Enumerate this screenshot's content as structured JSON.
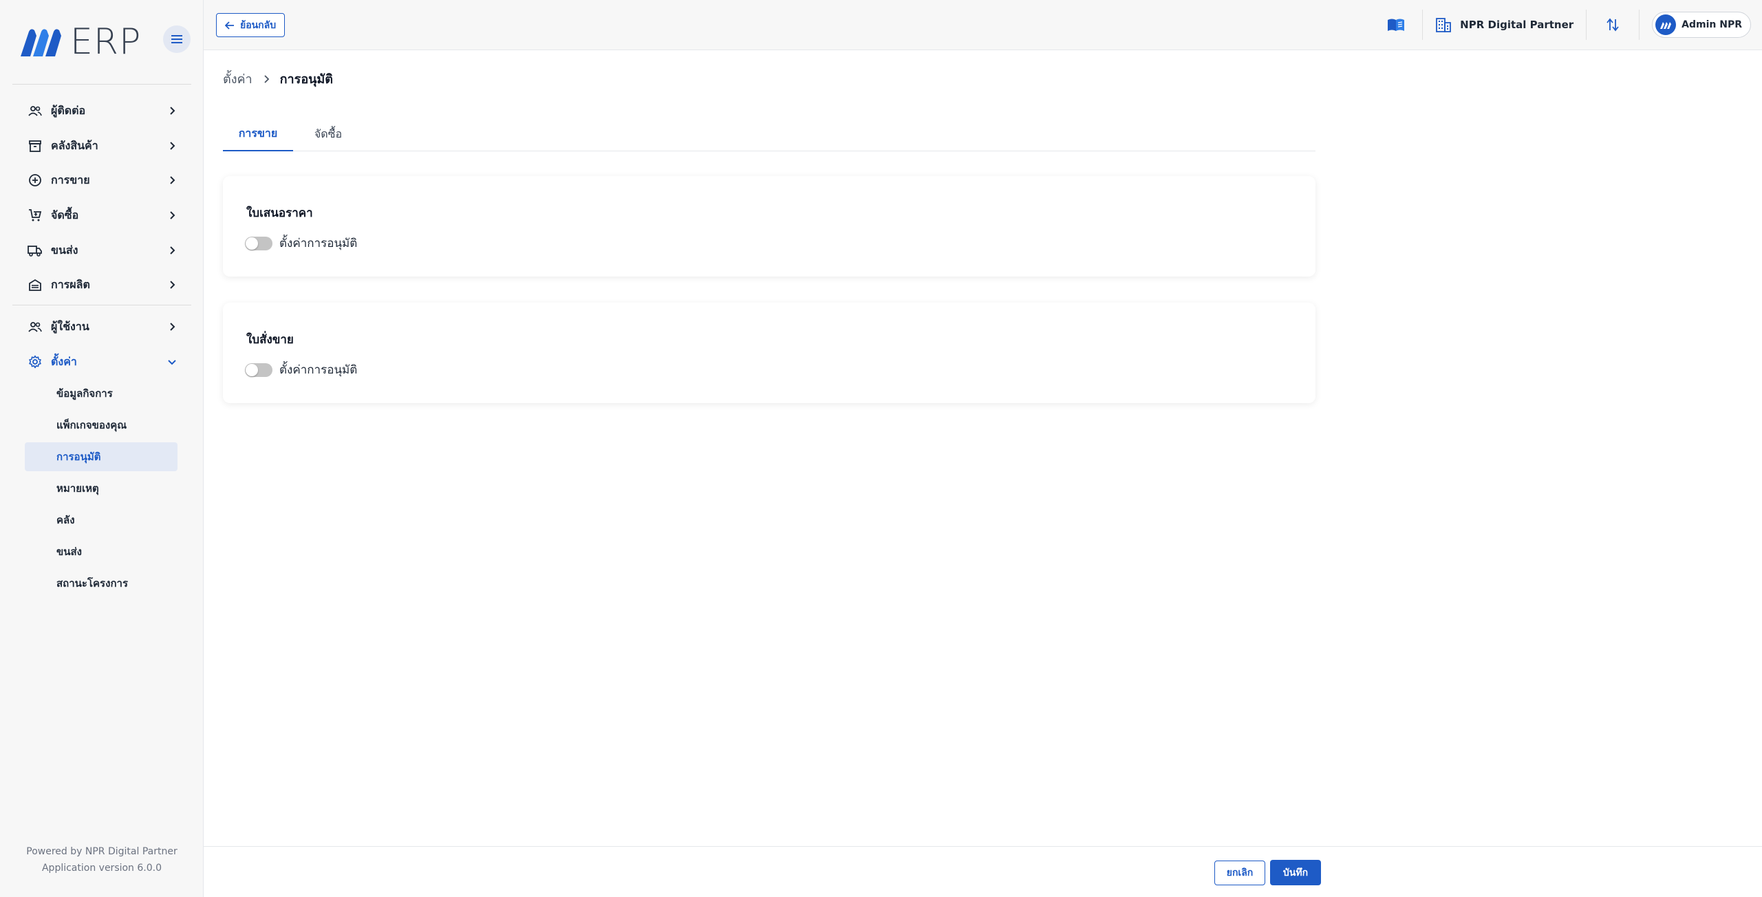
{
  "app": {
    "logo_text": "ERP",
    "brand_color": "#1e5bc6"
  },
  "sidebar": {
    "menu_toggle_icon": "hamburger-icon",
    "main_items": [
      {
        "label": "ผู้ติดต่อ",
        "icon": "contacts-icon"
      },
      {
        "label": "คลังสินค้า",
        "icon": "archive-icon"
      },
      {
        "label": "การขาย",
        "icon": "plus-circle-icon"
      },
      {
        "label": "จัดซื้อ",
        "icon": "cart-icon"
      },
      {
        "label": "ขนส่ง",
        "icon": "truck-icon"
      },
      {
        "label": "การผลิต",
        "icon": "factory-icon"
      }
    ],
    "admin_items": [
      {
        "label": "ผู้ใช้งาน",
        "icon": "users-icon"
      },
      {
        "label": "ตั้งค่า",
        "icon": "gear-icon"
      }
    ],
    "settings_sub_items": [
      {
        "label": "ข้อมูลกิจการ"
      },
      {
        "label": "แพ็กเกจของคุณ"
      },
      {
        "label": "การอนุมัติ"
      },
      {
        "label": "หมายเหตุ"
      },
      {
        "label": "คลัง"
      },
      {
        "label": "ขนส่ง"
      },
      {
        "label": "สถานะโครงการ"
      }
    ],
    "footer_line1": "Powered by NPR Digital Partner",
    "footer_line2": "Application version 6.0.0"
  },
  "topbar": {
    "back_label": "ย้อนกลับ",
    "manual_icon": "book-icon",
    "company_icon": "building-icon",
    "company_name": "NPR Digital Partner",
    "switch_icon": "swap-vertical-icon",
    "user_name": "Admin NPR"
  },
  "breadcrumb": {
    "parent": "ตั้งค่า",
    "current": "การอนุมัติ"
  },
  "tabs": [
    {
      "label": "การขาย",
      "active": true
    },
    {
      "label": "จัดซื้อ",
      "active": false
    }
  ],
  "cards": [
    {
      "title": "ใบเสนอราคา",
      "toggle_label": "ตั้งค่าการอนุมัติ",
      "toggle_on": false
    },
    {
      "title": "ใบสั่งขาย",
      "toggle_label": "ตั้งค่าการอนุมัติ",
      "toggle_on": false
    }
  ],
  "footer": {
    "cancel_label": "ยกเลิก",
    "save_label": "บันทึก"
  }
}
